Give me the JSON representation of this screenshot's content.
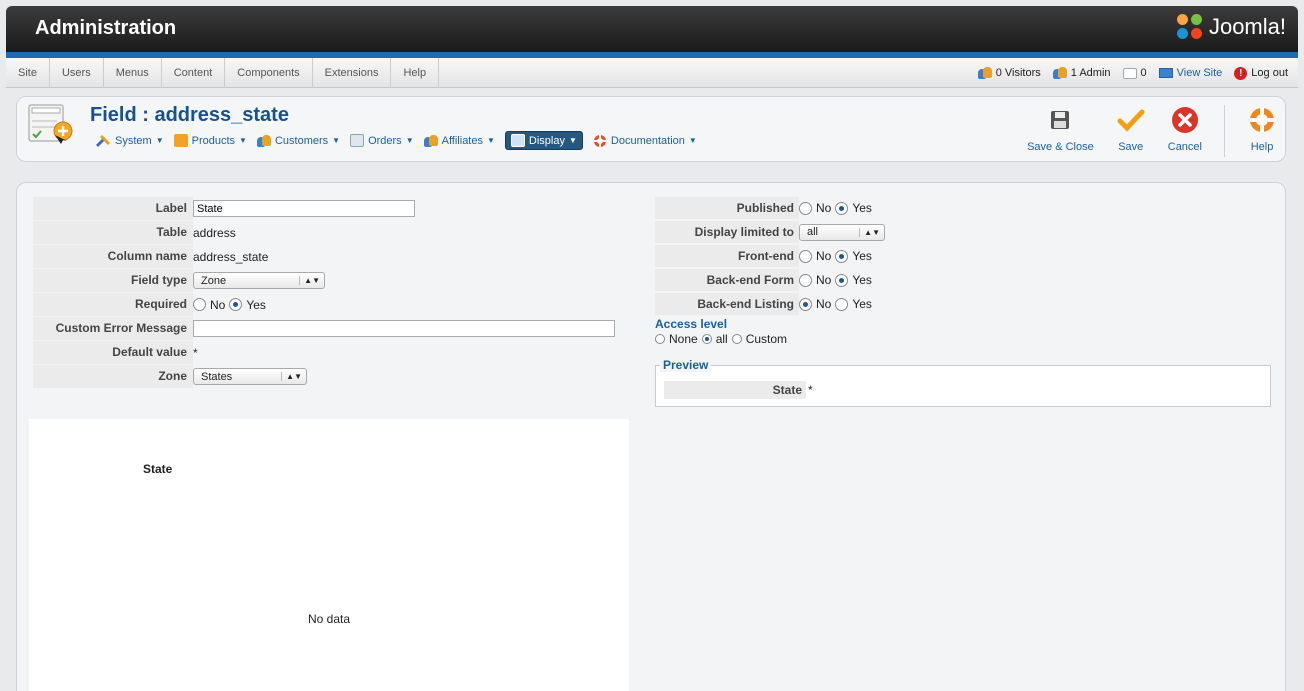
{
  "header": {
    "title": "Administration",
    "brand": "Joomla!"
  },
  "menu": [
    "Site",
    "Users",
    "Menus",
    "Content",
    "Components",
    "Extensions",
    "Help"
  ],
  "status": {
    "visitors": "0 Visitors",
    "admins": "1 Admin",
    "messages": "0",
    "view_site": "View Site",
    "logout": "Log out"
  },
  "toolbar": {
    "page_title": "Field : address_state",
    "submenu": [
      "System",
      "Products",
      "Customers",
      "Orders",
      "Affiliates",
      "Display",
      "Documentation"
    ],
    "buttons": {
      "save_close": "Save & Close",
      "save": "Save",
      "cancel": "Cancel",
      "help": "Help"
    }
  },
  "form": {
    "label": {
      "label": "Label",
      "value": "State"
    },
    "table": {
      "label": "Table",
      "value": "address"
    },
    "column": {
      "label": "Column name",
      "value": "address_state"
    },
    "field_type": {
      "label": "Field type",
      "value": "Zone"
    },
    "required": {
      "label": "Required",
      "no": "No",
      "yes": "Yes",
      "selected": "Yes"
    },
    "custom_error": {
      "label": "Custom Error Message",
      "value": ""
    },
    "default_value": {
      "label": "Default value",
      "value": "*"
    },
    "zone": {
      "label": "Zone",
      "value": "States"
    }
  },
  "options": {
    "published": {
      "label": "Published",
      "no": "No",
      "yes": "Yes",
      "selected": "Yes"
    },
    "display_limited": {
      "label": "Display limited to",
      "value": "all"
    },
    "front_end": {
      "label": "Front-end",
      "no": "No",
      "yes": "Yes",
      "selected": "Yes"
    },
    "backend_form": {
      "label": "Back-end Form",
      "no": "No",
      "yes": "Yes",
      "selected": "Yes"
    },
    "backend_listing": {
      "label": "Back-end Listing",
      "no": "No",
      "yes": "Yes",
      "selected": "No"
    },
    "access": {
      "title": "Access level",
      "none": "None",
      "all": "all",
      "custom": "Custom",
      "selected": "all"
    }
  },
  "preview": {
    "legend": "Preview",
    "label": "State",
    "value": "*"
  },
  "chart": {
    "title": "State",
    "empty": "No data"
  }
}
